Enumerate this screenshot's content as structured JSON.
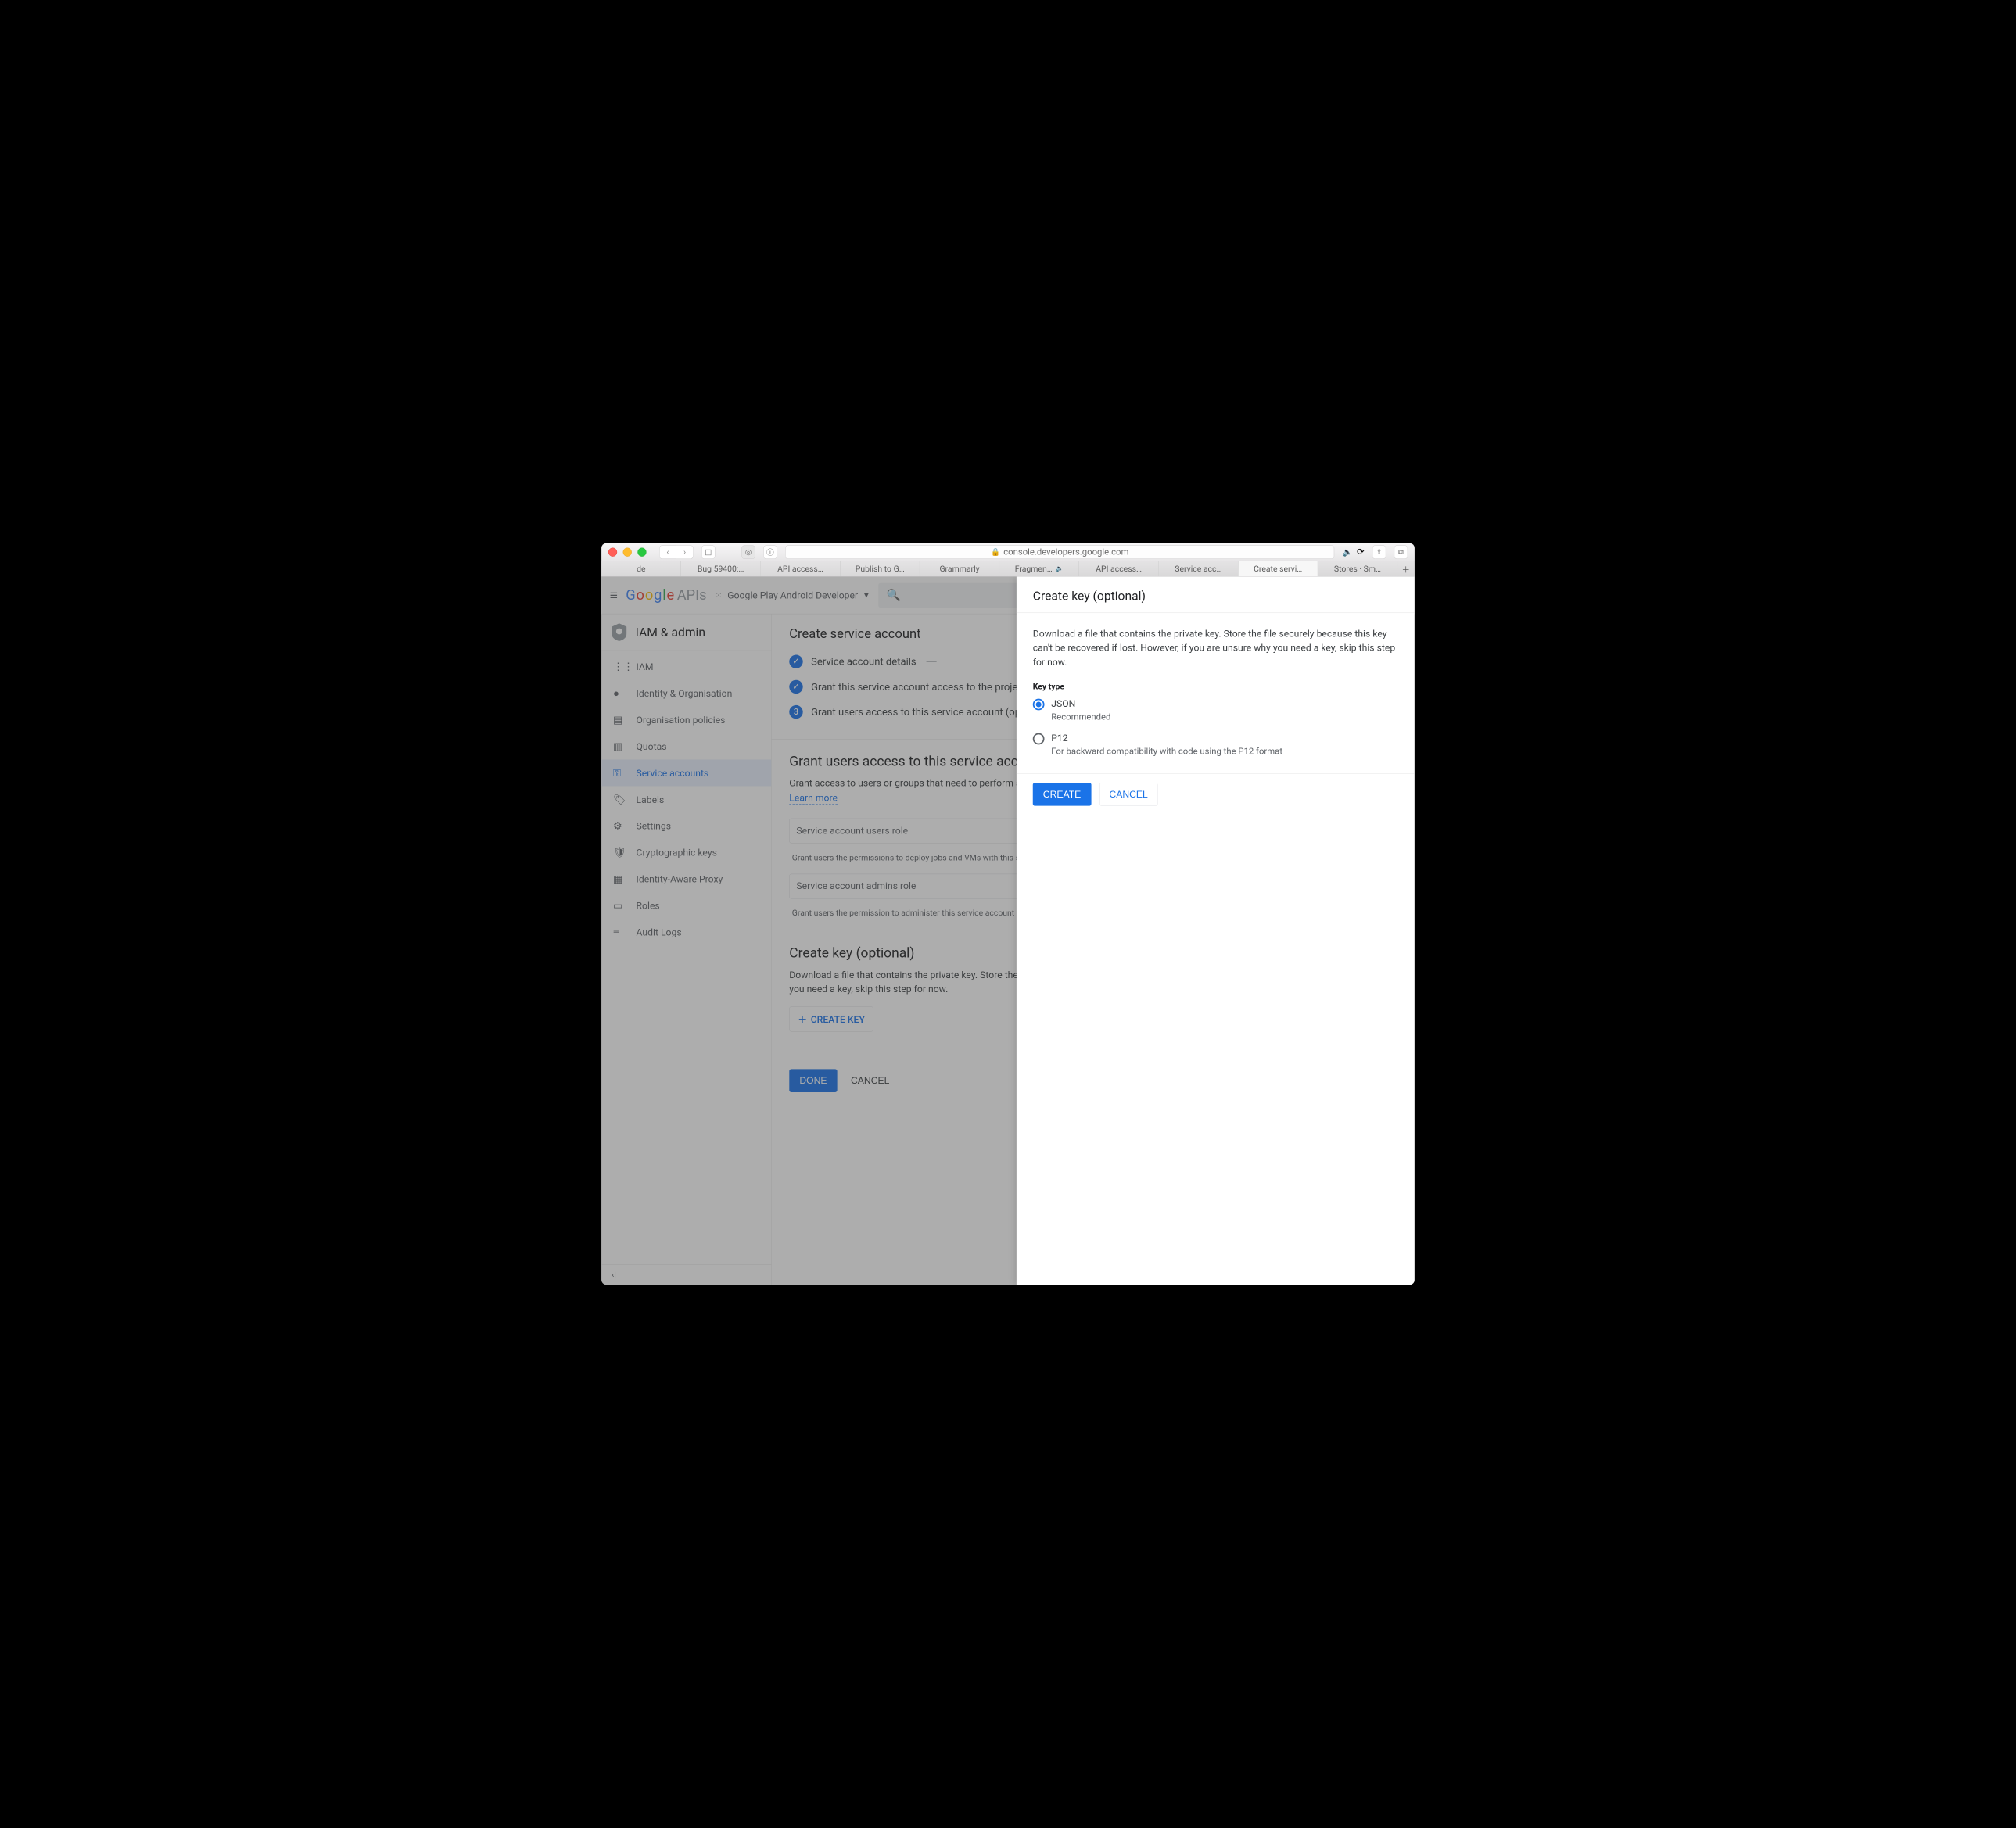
{
  "url": "console.developers.google.com",
  "safari_tabs": [
    {
      "label": "de"
    },
    {
      "label": "Bug 59400:…"
    },
    {
      "label": "API access…"
    },
    {
      "label": "Publish to G…"
    },
    {
      "label": "Grammarly"
    },
    {
      "label": "Fragmen…",
      "sound": true
    },
    {
      "label": "API access…"
    },
    {
      "label": "Service acc…"
    },
    {
      "label": "Create servi…",
      "active": true
    },
    {
      "label": "Stores · Sm…"
    }
  ],
  "header": {
    "logo_text": "Google",
    "logo_suffix": "APIs",
    "project": "Google Play Android Developer"
  },
  "sidebar": {
    "title": "IAM & admin",
    "items": [
      {
        "icon": "👥",
        "label": "IAM"
      },
      {
        "icon": "👤",
        "label": "Identity & Organisation"
      },
      {
        "icon": "▤",
        "label": "Organisation policies"
      },
      {
        "icon": "▥",
        "label": "Quotas"
      },
      {
        "icon": "⚙",
        "label": "Service accounts",
        "active": true
      },
      {
        "icon": "🏷",
        "label": "Labels"
      },
      {
        "icon": "⚙",
        "label": "Settings"
      },
      {
        "icon": "🛡",
        "label": "Cryptographic keys"
      },
      {
        "icon": "▦",
        "label": "Identity-Aware Proxy"
      },
      {
        "icon": "▭",
        "label": "Roles"
      },
      {
        "icon": "≡",
        "label": "Audit Logs"
      }
    ]
  },
  "main": {
    "title": "Create service account",
    "steps": [
      {
        "done": true,
        "label": "Service account details",
        "dash": true
      },
      {
        "done": true,
        "label": "Grant this service account access to the project (optional)"
      },
      {
        "num": "3",
        "label": "Grant users access to this service account (optional)"
      }
    ],
    "section1": {
      "title": "Grant users access to this service account (optional)",
      "desc": "Grant access to users or groups that need to perform actions as this service account.",
      "learn": "Learn more",
      "field1_label": "Service account users role",
      "field1_hint": "Grant users the permissions to deploy jobs and VMs with this service account",
      "field2_label": "Service account admins role",
      "field2_hint": "Grant users the permission to administer this service account"
    },
    "section2": {
      "title": "Create key (optional)",
      "desc": "Download a file that contains the private key. Store the file securely because this key can't be recovered if lost. However, if you are unsure why you need a key, skip this step for now.",
      "create_key": "CREATE KEY"
    },
    "done": "DONE",
    "cancel": "CANCEL"
  },
  "panel": {
    "title": "Create key (optional)",
    "desc": "Download a file that contains the private key. Store the file securely because this key can't be recovered if lost. However, if you are unsure why you need a key, skip this step for now.",
    "keytype": "Key type",
    "opt1_label": "JSON",
    "opt1_sub": "Recommended",
    "opt2_label": "P12",
    "opt2_sub": "For backward compatibility with code using the P12 format",
    "create": "CREATE",
    "cancel": "CANCEL"
  }
}
